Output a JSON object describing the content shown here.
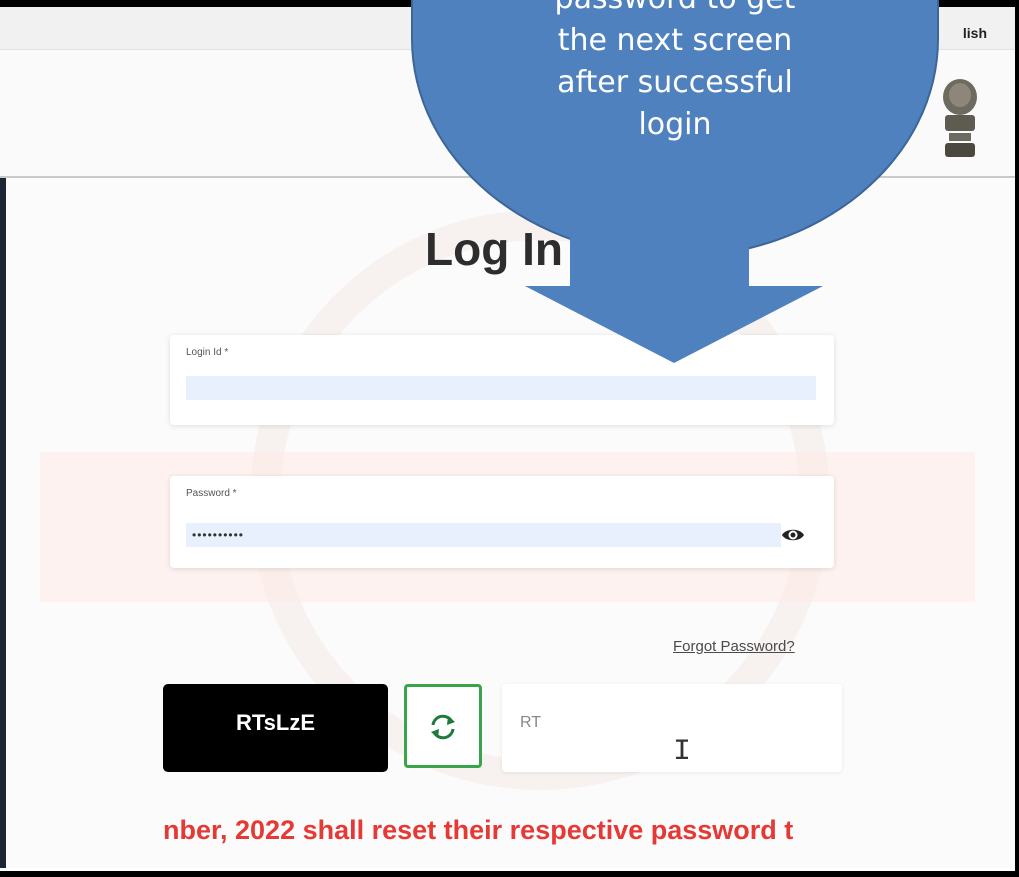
{
  "topbar": {
    "language": "lish"
  },
  "login": {
    "title": "Log In",
    "login_id_label": "Login Id *",
    "password_label": "Password *",
    "password_value": "••••••••••",
    "forgot_password": "Forgot Password?",
    "captcha_code": "RTsLzE",
    "captcha_input_value": "RT"
  },
  "notice": "nber, 2022 shall reset their respective password t",
  "callout": {
    "lines": [
      "password to get",
      "the next screen",
      "after successful",
      "login"
    ]
  },
  "icons": [
    "emblem-icon",
    "eye-icon",
    "refresh-icon",
    "text-cursor-icon"
  ],
  "colors": {
    "callout": "#4e81bd",
    "notice": "#e53935",
    "refresh_border": "#39a54a",
    "input_autofill": "#e8f0fe"
  }
}
